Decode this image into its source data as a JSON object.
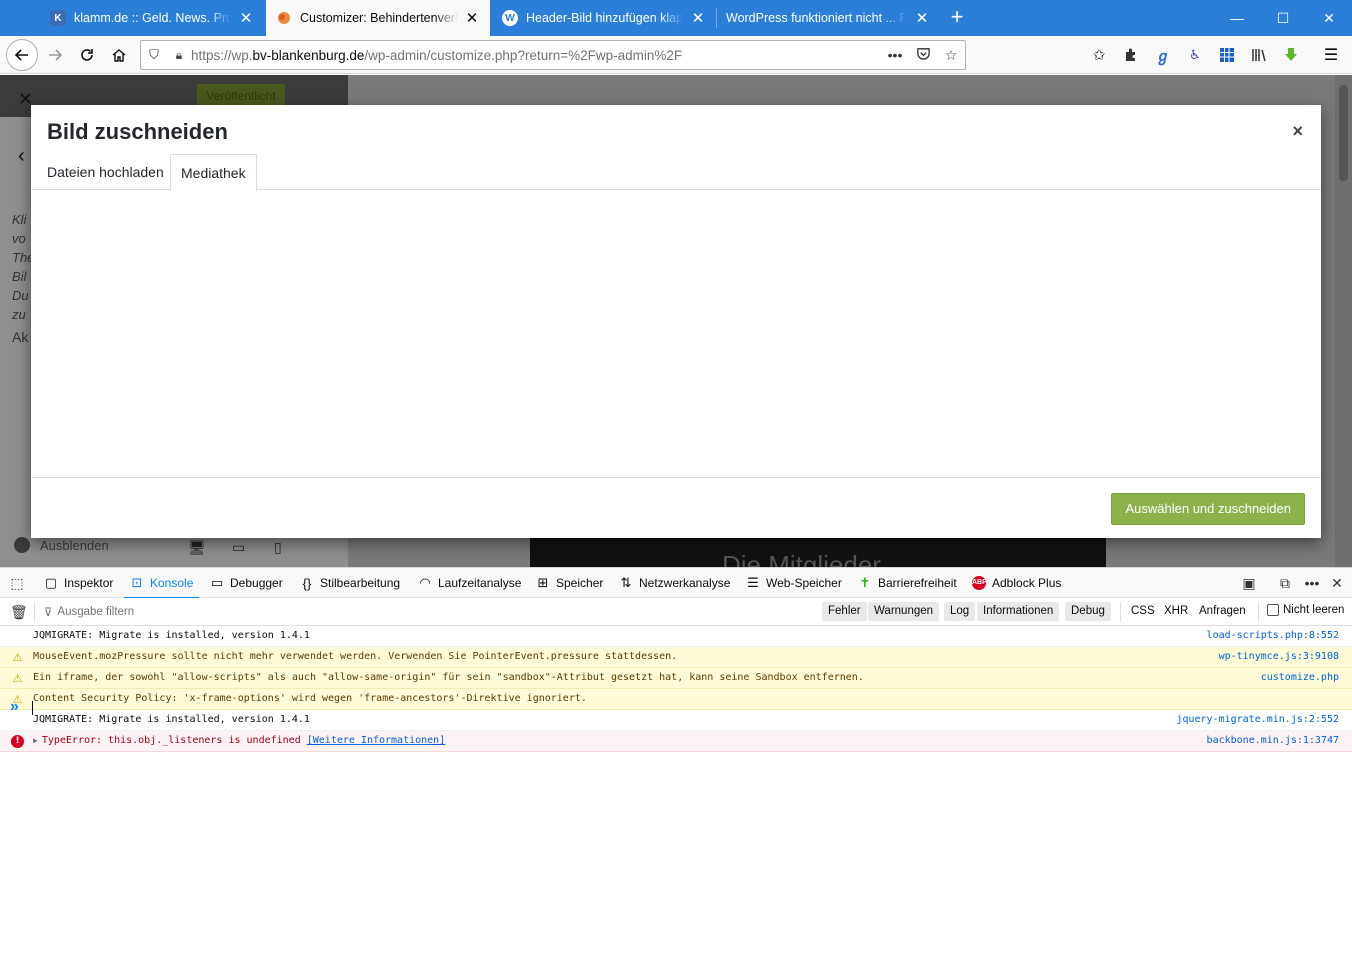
{
  "tabs": [
    {
      "title": "klamm.de :: Geld. News. Promotions",
      "favicon_color": "#3b6db3",
      "favicon_letter": "K",
      "active": false
    },
    {
      "title": "Customizer: Behindertenverband",
      "favicon_color": "#e86a2c",
      "favicon_letter": "",
      "active": true
    },
    {
      "title": "Header-Bild hinzufügen klappt",
      "favicon_color": "#ffffff",
      "favicon_letter": "W",
      "active": false
    },
    {
      "title": "WordPress funktioniert nicht ... Fehler",
      "favicon_color": "",
      "favicon_letter": "",
      "active": false
    }
  ],
  "window": {
    "minimize": "—",
    "maximize": "☐",
    "close": "✕",
    "new_tab": "+"
  },
  "url": {
    "prefix": "https://wp.",
    "domain": "bv-blankenburg.de",
    "path": "/wp-admin/customize.php?return=%2Fwp-admin%2F"
  },
  "background": {
    "publish_label": "Veröffentlicht",
    "side_text": [
      "Kli",
      "vo",
      "The",
      "Bil",
      "Du",
      "zu"
    ],
    "section_label": "Ak",
    "hide_label": "Ausblenden",
    "banner_text": "Die Mitglieder"
  },
  "modal": {
    "title": "Bild zuschneiden",
    "close": "×",
    "tabs": [
      {
        "label": "Dateien hochladen"
      },
      {
        "label": "Mediathek"
      }
    ],
    "select_button": "Auswählen und zuschneiden"
  },
  "devtools": {
    "tabs": [
      {
        "label": "Inspektor",
        "icon": "inspector-icon"
      },
      {
        "label": "Konsole",
        "icon": "console-icon"
      },
      {
        "label": "Debugger",
        "icon": "debugger-icon"
      },
      {
        "label": "Stilbearbeitung",
        "icon": "style-editor-icon"
      },
      {
        "label": "Laufzeitanalyse",
        "icon": "performance-icon"
      },
      {
        "label": "Speicher",
        "icon": "memory-icon"
      },
      {
        "label": "Netzwerkanalyse",
        "icon": "network-icon"
      },
      {
        "label": "Web-Speicher",
        "icon": "storage-icon"
      },
      {
        "label": "Barrierefreiheit",
        "icon": "accessibility-icon"
      },
      {
        "label": "Adblock Plus",
        "icon": "adblock-icon"
      }
    ],
    "active_tab": "Konsole",
    "filter_placeholder": "Ausgabe filtern",
    "levels": [
      "Fehler",
      "Warnungen",
      "Log",
      "Informationen",
      "Debug"
    ],
    "request_filters": [
      "CSS",
      "XHR",
      "Anfragen"
    ],
    "persist_label": "Nicht leeren",
    "messages": [
      {
        "level": "log",
        "text": "JQMIGRATE: Migrate is installed, version 1.4.1",
        "source": "load-scripts.php:8:552"
      },
      {
        "level": "warn",
        "text": "MouseEvent.mozPressure sollte nicht mehr verwendet werden. Verwenden Sie PointerEvent.pressure stattdessen.",
        "source": "wp-tinymce.js:3:9108"
      },
      {
        "level": "warn",
        "text": "Ein iframe, der sowohl \"allow-scripts\" als auch \"allow-same-origin\" für sein \"sandbox\"-Attribut gesetzt hat, kann seine Sandbox entfernen.",
        "source": "customize.php"
      },
      {
        "level": "warn",
        "text": "Content Security Policy: 'x-frame-options' wird wegen 'frame-ancestors'-Direktive ignoriert.",
        "source": ""
      },
      {
        "level": "log",
        "text": "JQMIGRATE: Migrate is installed, version 1.4.1",
        "source": "jquery-migrate.min.js:2:552"
      },
      {
        "level": "error",
        "text": "TypeError: this.obj._listeners is undefined",
        "link": "[Weitere Informationen]",
        "source": "backbone.min.js:1:3747"
      }
    ],
    "prompt": "»"
  },
  "colors": {
    "tabbar": "#2b7fd9",
    "accent": "#0a84ff",
    "wp_button": "#8eb24b"
  }
}
